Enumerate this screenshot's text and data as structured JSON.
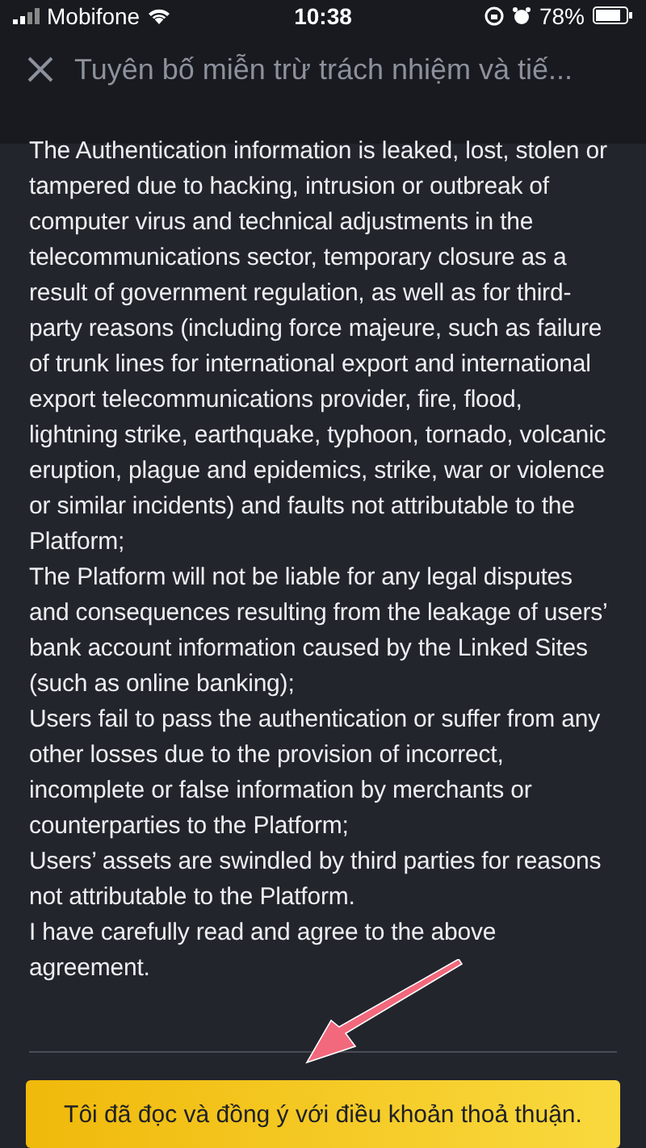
{
  "status_bar": {
    "carrier": "Mobifone",
    "time": "10:38",
    "battery": "78%"
  },
  "header": {
    "title": "Tuyên bố miễn trừ trách nhiệm và tiế..."
  },
  "paragraphs": [
    "The Authentication information is leaked, lost, stolen or tampered due to hacking, intrusion or outbreak of computer virus and technical adjustments in the telecommunications sector, temporary closure as a result of government regulation, as well as for third-party reasons (including force majeure, such as failure of trunk lines for international export and international export telecommunications provider, fire, flood, lightning strike, earthquake, typhoon, tornado, volcanic eruption, plague and epidemics, strike, war or violence or similar incidents) and faults not attributable to the Platform;",
    "The Platform will not be liable for any legal disputes and consequences resulting from the leakage of users’ bank account information caused by the Linked Sites (such as online banking);",
    "Users fail to pass the authentication or suffer from any other losses due to the provision of incorrect, incomplete or false information by merchants or counterparties to the Platform;",
    "Users’ assets are swindled by third parties for reasons not attributable to the Platform.",
    "I have carefully read and agree to the above agreement."
  ],
  "agree_button": {
    "label": "Tôi đã đọc và đồng ý với điều khoản thoả thuận."
  }
}
